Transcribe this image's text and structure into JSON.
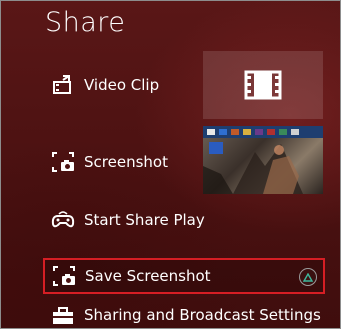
{
  "title": "Share",
  "menu": {
    "video_clip": {
      "label": "Video Clip",
      "icon": "video-clip-icon"
    },
    "screenshot": {
      "label": "Screenshot",
      "icon": "screenshot-icon"
    },
    "start_share_play": {
      "label": "Start Share Play",
      "icon": "share-play-icon"
    },
    "save_screenshot": {
      "label": "Save Screenshot",
      "icon": "save-screenshot-icon",
      "button_hint": "triangle-button-icon"
    },
    "settings": {
      "label": "Sharing and Broadcast Settings",
      "icon": "toolbox-icon"
    }
  },
  "colors": {
    "background": "#4d1212",
    "highlight_border": "#d61e24",
    "text": "#ffffff"
  }
}
